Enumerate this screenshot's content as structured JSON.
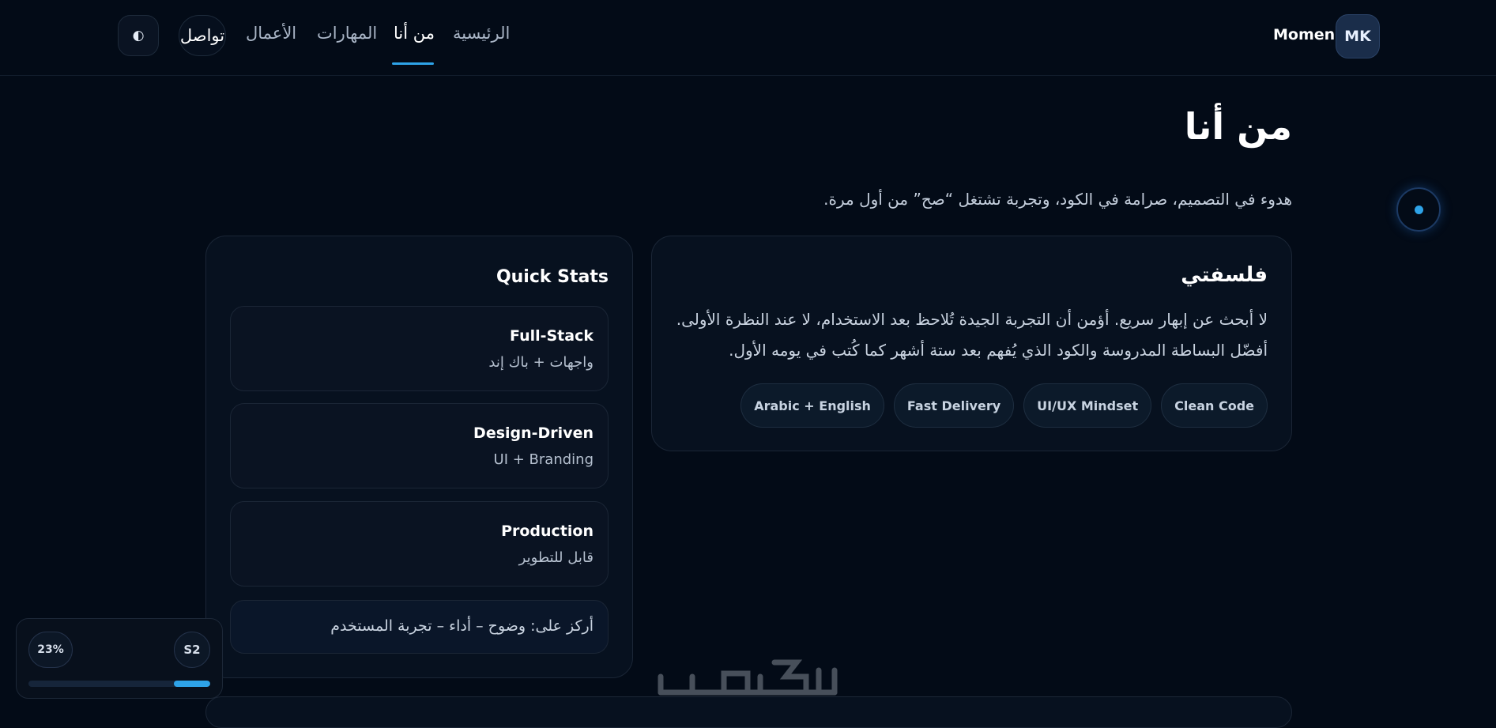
{
  "header": {
    "theme_icon": "◐",
    "contact_label": "تواصل",
    "nav": [
      "الأعمال",
      "المهارات",
      "من أنا",
      "الرئيسية"
    ],
    "brand_name": "Momen",
    "brand_initials": "MK"
  },
  "about": {
    "title": "من أنا",
    "subtitle": "هدوء في التصميم، صرامة في الكود، وتجربة تشتغل “صح” من أول مرة."
  },
  "philosophy": {
    "title": "فلسفتي",
    "body": "لا أبحث عن إبهار سريع. أؤمن أن التجربة الجيدة تُلاحظ بعد الاستخدام، لا عند النظرة الأولى. أفضّل البساطة المدروسة والكود الذي يُفهم بعد ستة أشهر كما كُتب في يومه الأول.",
    "tags": [
      "Clean Code",
      "UI/UX Mindset",
      "Fast Delivery",
      "Arabic + English"
    ]
  },
  "quick_stats": {
    "title": "Quick Stats",
    "items": [
      {
        "title": "Full-Stack",
        "subtitle": "واجهات + باك إند"
      },
      {
        "title": "Design-Driven",
        "subtitle": "UI + Branding"
      },
      {
        "title": "Production",
        "subtitle": "قابل للتطوير"
      }
    ],
    "focus": "أركز على: وضوح – أداء – تجربة المستخدم"
  },
  "progress": {
    "percent_label": "23%",
    "section_label": "S2",
    "value": 0.2
  },
  "colors": {
    "background": "#030b17",
    "accent": "#2ea3e8",
    "card": "#07111f"
  }
}
